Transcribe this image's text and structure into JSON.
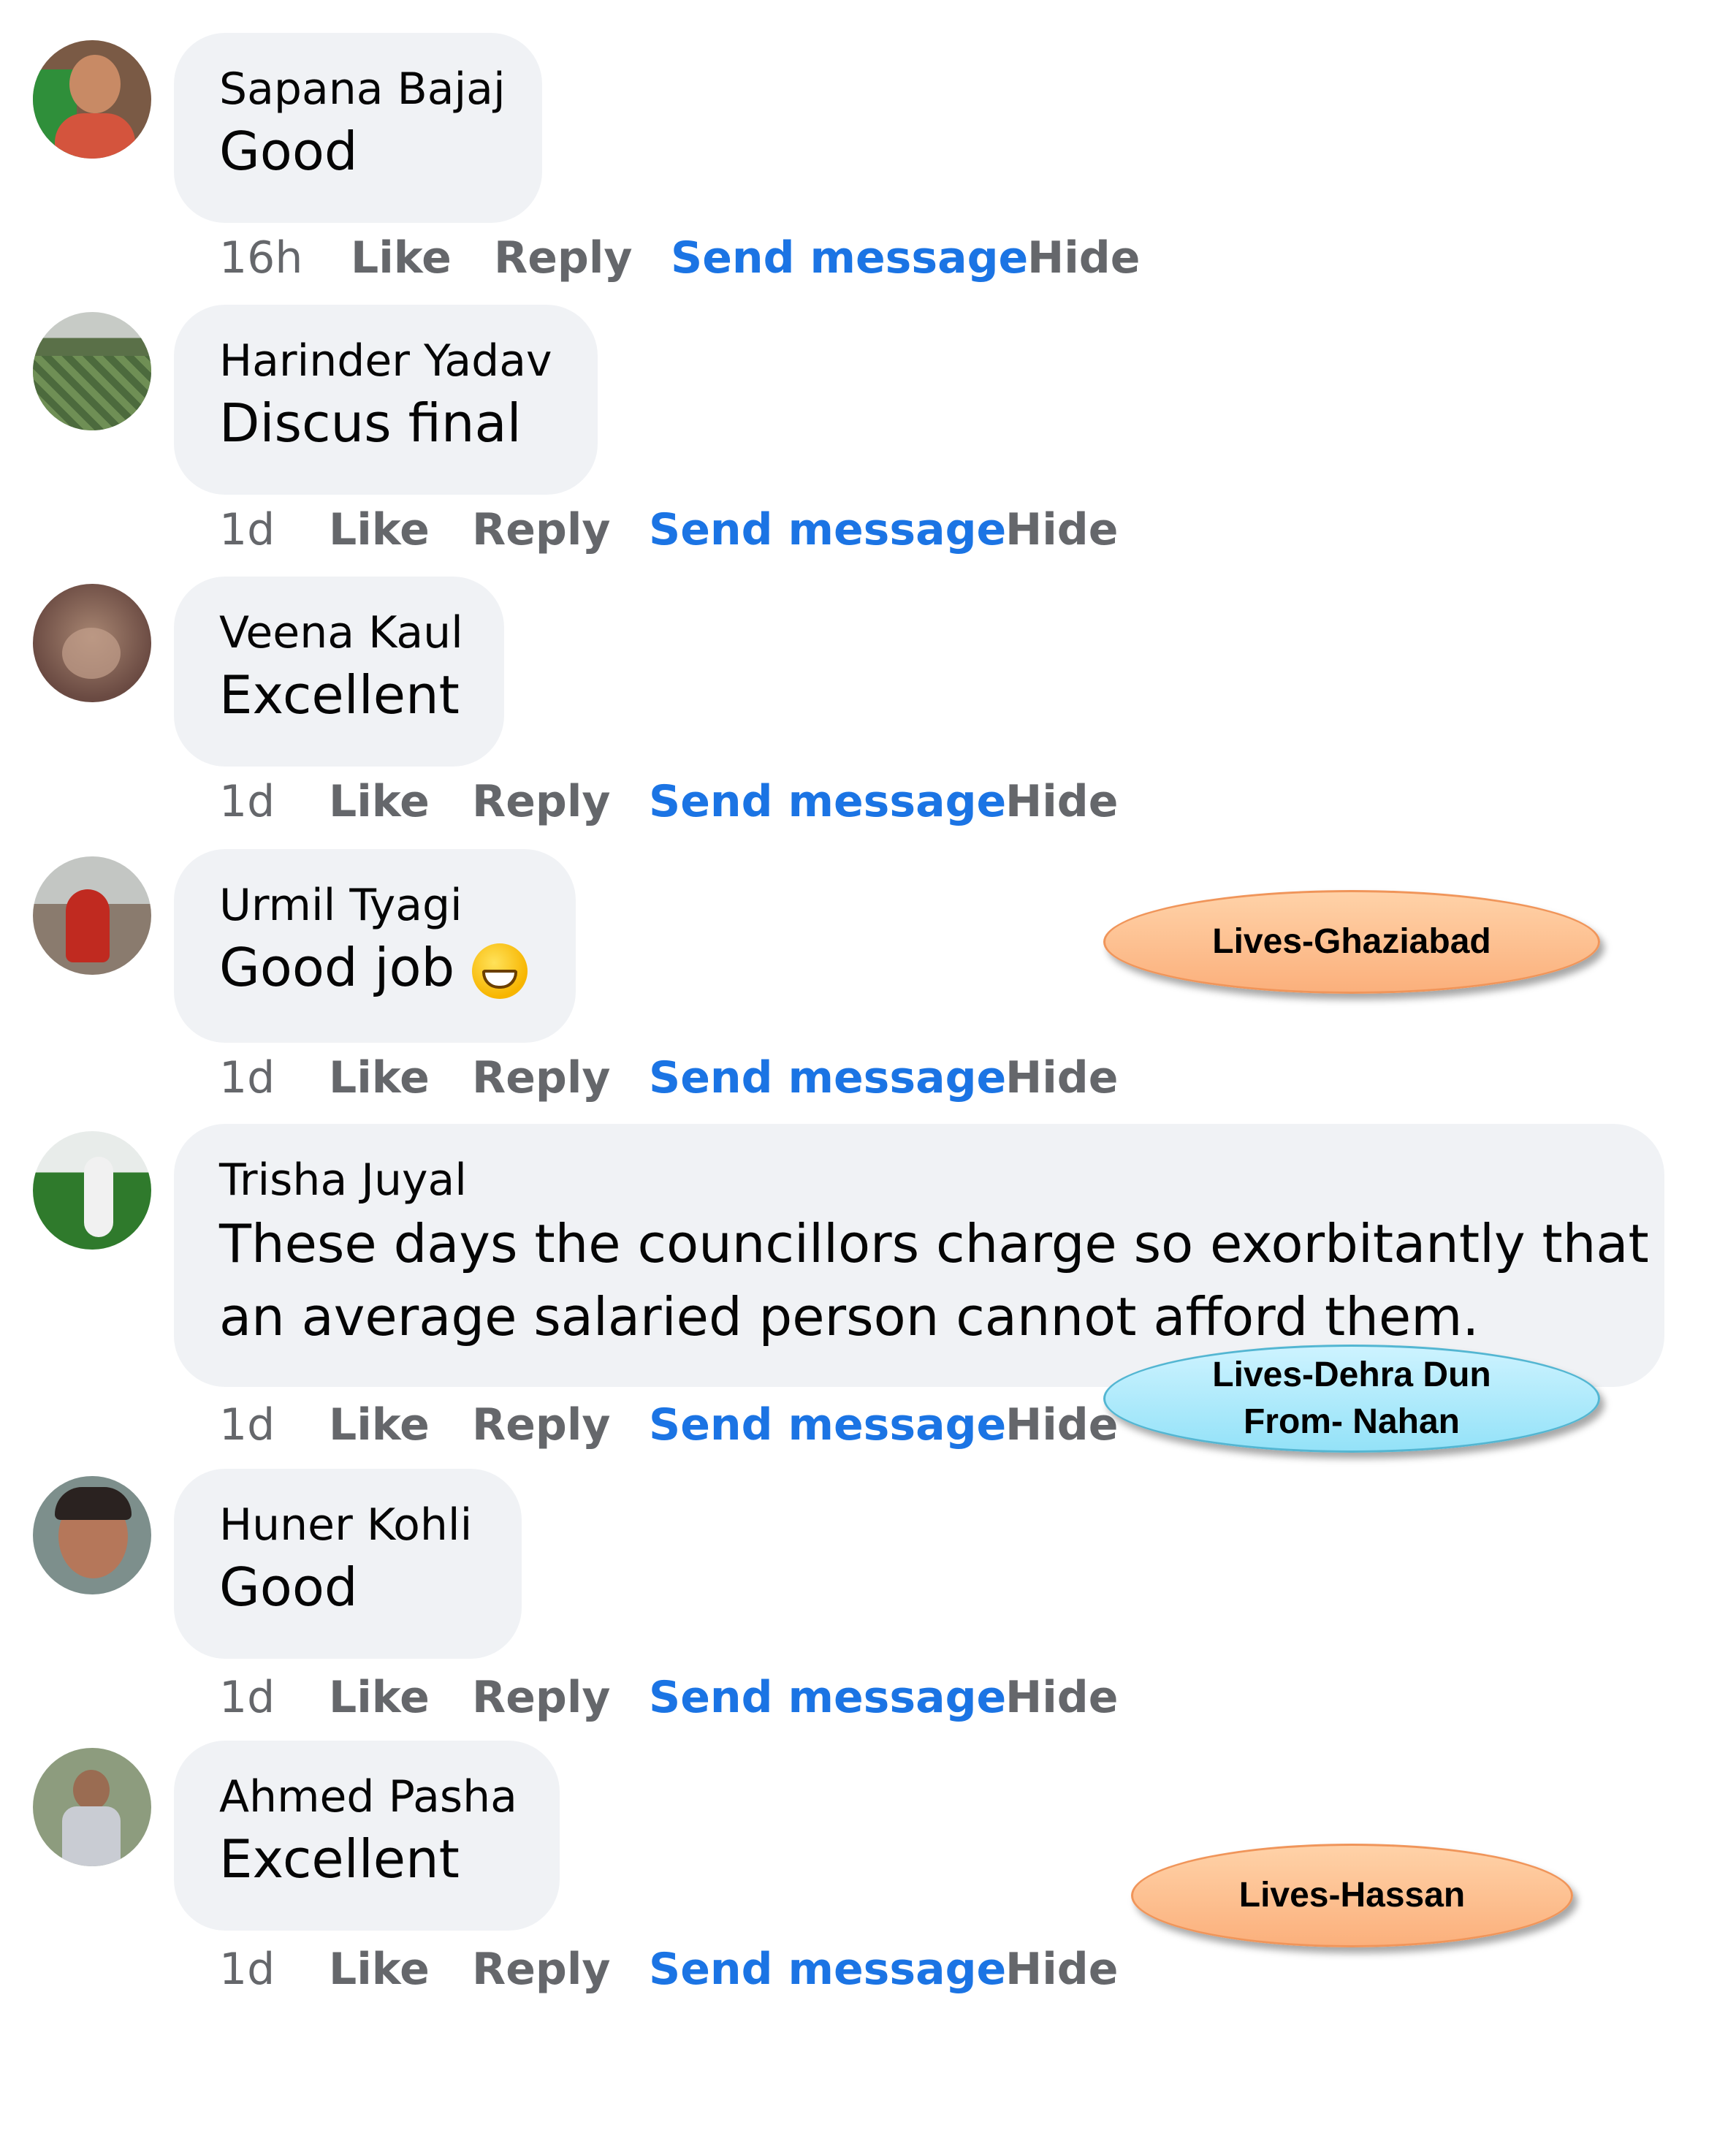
{
  "comments": [
    {
      "name": "Sapana Bajaj",
      "text": "Good",
      "time": "16h",
      "avatar_icon": "profile-photo"
    },
    {
      "name": "Harinder Yadav",
      "text": "Discus final",
      "time": "1d",
      "avatar_icon": "profile-photo"
    },
    {
      "name": "Veena Kaul",
      "text": "Excellent",
      "time": "1d",
      "avatar_icon": "profile-photo"
    },
    {
      "name": "Urmil Tyagi",
      "text": "Good job",
      "time": "1d",
      "emoji": "grinning-face-icon",
      "avatar_icon": "profile-photo"
    },
    {
      "name": "Trisha Juyal",
      "text": "These days the councillors charge so exorbitantly that an average salaried person cannot afford them.",
      "time": "1d",
      "avatar_icon": "profile-photo"
    },
    {
      "name": "Huner Kohli",
      "text": "Good",
      "time": "1d",
      "avatar_icon": "profile-photo"
    },
    {
      "name": "Ahmed Pasha",
      "text": "Excellent",
      "time": "1d",
      "avatar_icon": "profile-photo"
    }
  ],
  "actions": {
    "like": "Like",
    "reply": "Reply",
    "send_message": "Send message",
    "hide": "Hide"
  },
  "annotations": [
    {
      "text": "Lives-Ghaziabad",
      "color": "#fbb07c"
    },
    {
      "line1": "Lives-Dehra Dun",
      "line2": "From- Nahan",
      "color": "#94e2f8"
    },
    {
      "text": "Lives-Hassan",
      "color": "#fbb07c"
    }
  ],
  "colors": {
    "bubble": "#f0f2f5",
    "link": "#1b74e4",
    "meta": "#65676b"
  }
}
